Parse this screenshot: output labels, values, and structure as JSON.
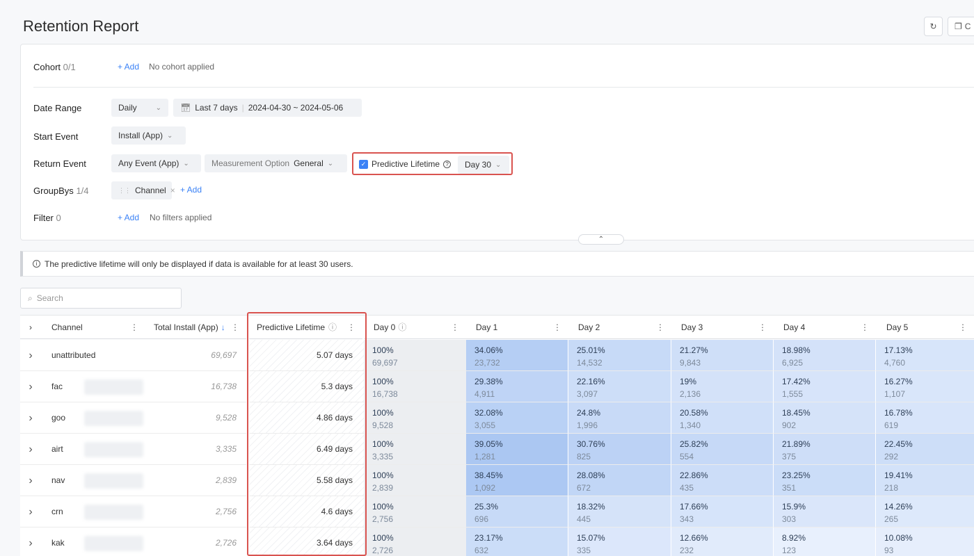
{
  "header": {
    "title": "Retention Report",
    "copy_label": "C"
  },
  "cohort": {
    "label": "Cohort",
    "count": "0/1",
    "add": "+ Add",
    "status": "No cohort applied"
  },
  "date_range": {
    "label": "Date Range",
    "granularity": "Daily",
    "preset": "Last 7 days",
    "range": "2024-04-30 ~ 2024-05-06"
  },
  "start_event": {
    "label": "Start Event",
    "value": "Install (App)"
  },
  "return_event": {
    "label": "Return Event",
    "value": "Any Event (App)",
    "measure_label": "Measurement Option",
    "measure_value": "General",
    "predictive_label": "Predictive Lifetime",
    "predictive_checked": true,
    "day_value": "Day 30"
  },
  "groupbys": {
    "label": "GroupBys",
    "count": "1/4",
    "chip": "Channel",
    "add": "+ Add"
  },
  "filter": {
    "label": "Filter",
    "count": "0",
    "add": "+ Add",
    "status": "No filters applied"
  },
  "notice": "The predictive lifetime will only be displayed if data is available for at least 30 users.",
  "search": {
    "placeholder": "Search"
  },
  "table": {
    "headers": {
      "channel": "Channel",
      "total": "Total Install (App)",
      "predictive": "Predictive Lifetime",
      "day0": "Day 0",
      "day1": "Day 1",
      "day2": "Day 2",
      "day3": "Day 3",
      "day4": "Day 4",
      "day5": "Day 5"
    },
    "rows": [
      {
        "channel": "unattributed",
        "total": "69,697",
        "pl": "5.07 days",
        "d0p": "100%",
        "d0n": "69,697",
        "d1p": "34.06%",
        "d1n": "23,732",
        "d2p": "25.01%",
        "d2n": "14,532",
        "d3p": "21.27%",
        "d3n": "9,843",
        "d4p": "18.98%",
        "d4n": "6,925",
        "d5p": "17.13%",
        "d5n": "4,760"
      },
      {
        "channel": "fac",
        "total": "16,738",
        "pl": "5.3 days",
        "d0p": "100%",
        "d0n": "16,738",
        "d1p": "29.38%",
        "d1n": "4,911",
        "d2p": "22.16%",
        "d2n": "3,097",
        "d3p": "19%",
        "d3n": "2,136",
        "d4p": "17.42%",
        "d4n": "1,555",
        "d5p": "16.27%",
        "d5n": "1,107"
      },
      {
        "channel": "goo",
        "total": "9,528",
        "pl": "4.86 days",
        "d0p": "100%",
        "d0n": "9,528",
        "d1p": "32.08%",
        "d1n": "3,055",
        "d2p": "24.8%",
        "d2n": "1,996",
        "d3p": "20.58%",
        "d3n": "1,340",
        "d4p": "18.45%",
        "d4n": "902",
        "d5p": "16.78%",
        "d5n": "619"
      },
      {
        "channel": "airt",
        "total": "3,335",
        "pl": "6.49 days",
        "d0p": "100%",
        "d0n": "3,335",
        "d1p": "39.05%",
        "d1n": "1,281",
        "d2p": "30.76%",
        "d2n": "825",
        "d3p": "25.82%",
        "d3n": "554",
        "d4p": "21.89%",
        "d4n": "375",
        "d5p": "22.45%",
        "d5n": "292"
      },
      {
        "channel": "nav",
        "total": "2,839",
        "pl": "5.58 days",
        "d0p": "100%",
        "d0n": "2,839",
        "d1p": "38.45%",
        "d1n": "1,092",
        "d2p": "28.08%",
        "d2n": "672",
        "d3p": "22.86%",
        "d3n": "435",
        "d4p": "23.25%",
        "d4n": "351",
        "d5p": "19.41%",
        "d5n": "218"
      },
      {
        "channel": "crn",
        "total": "2,756",
        "pl": "4.6 days",
        "d0p": "100%",
        "d0n": "2,756",
        "d1p": "25.3%",
        "d1n": "696",
        "d2p": "18.32%",
        "d2n": "445",
        "d3p": "17.66%",
        "d3n": "343",
        "d4p": "15.9%",
        "d4n": "303",
        "d5p": "14.26%",
        "d5n": "265"
      },
      {
        "channel": "kak",
        "total": "2,726",
        "pl": "3.64 days",
        "d0p": "100%",
        "d0n": "2,726",
        "d1p": "23.17%",
        "d1n": "632",
        "d2p": "15.07%",
        "d2n": "335",
        "d3p": "12.66%",
        "d3n": "232",
        "d4p": "8.92%",
        "d4n": "123",
        "d5p": "10.08%",
        "d5n": "93"
      }
    ]
  },
  "colors": {
    "accent": "#3b82f6",
    "highlight": "#d9534f",
    "heat_low": "#eaf1fd",
    "heat_high": "#a9c6f2"
  }
}
